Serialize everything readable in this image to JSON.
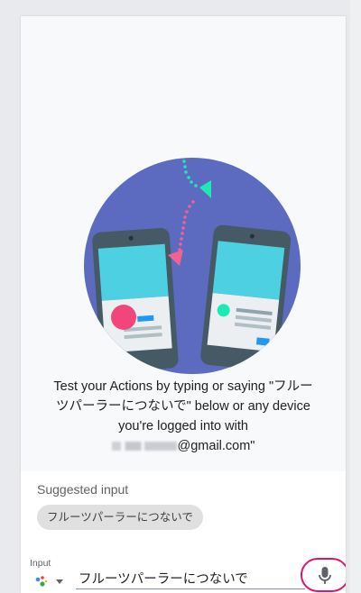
{
  "welcome": {
    "line1": "Test your Actions by typing or saying \"フルー",
    "line2": "ツパーラーにつないで\" below or any device",
    "line3": "you're logged into with",
    "email_suffix": "@gmail.com\""
  },
  "suggested": {
    "label": "Suggested input",
    "chips": [
      "フルーツパーラーにつないで"
    ]
  },
  "input": {
    "label": "Input",
    "value": "フルーツパーラーにつないで"
  },
  "icons": {
    "assistant": "assistant-dots-icon",
    "dropdown": "chevron-down-icon",
    "mic": "microphone-icon"
  },
  "colors": {
    "circle": "#5c6bc0",
    "phone": "#455a64",
    "screen": "#4dd0e1",
    "pink": "#f0467b",
    "teal": "#1de9b6",
    "mic_highlight": "#e0136c"
  }
}
